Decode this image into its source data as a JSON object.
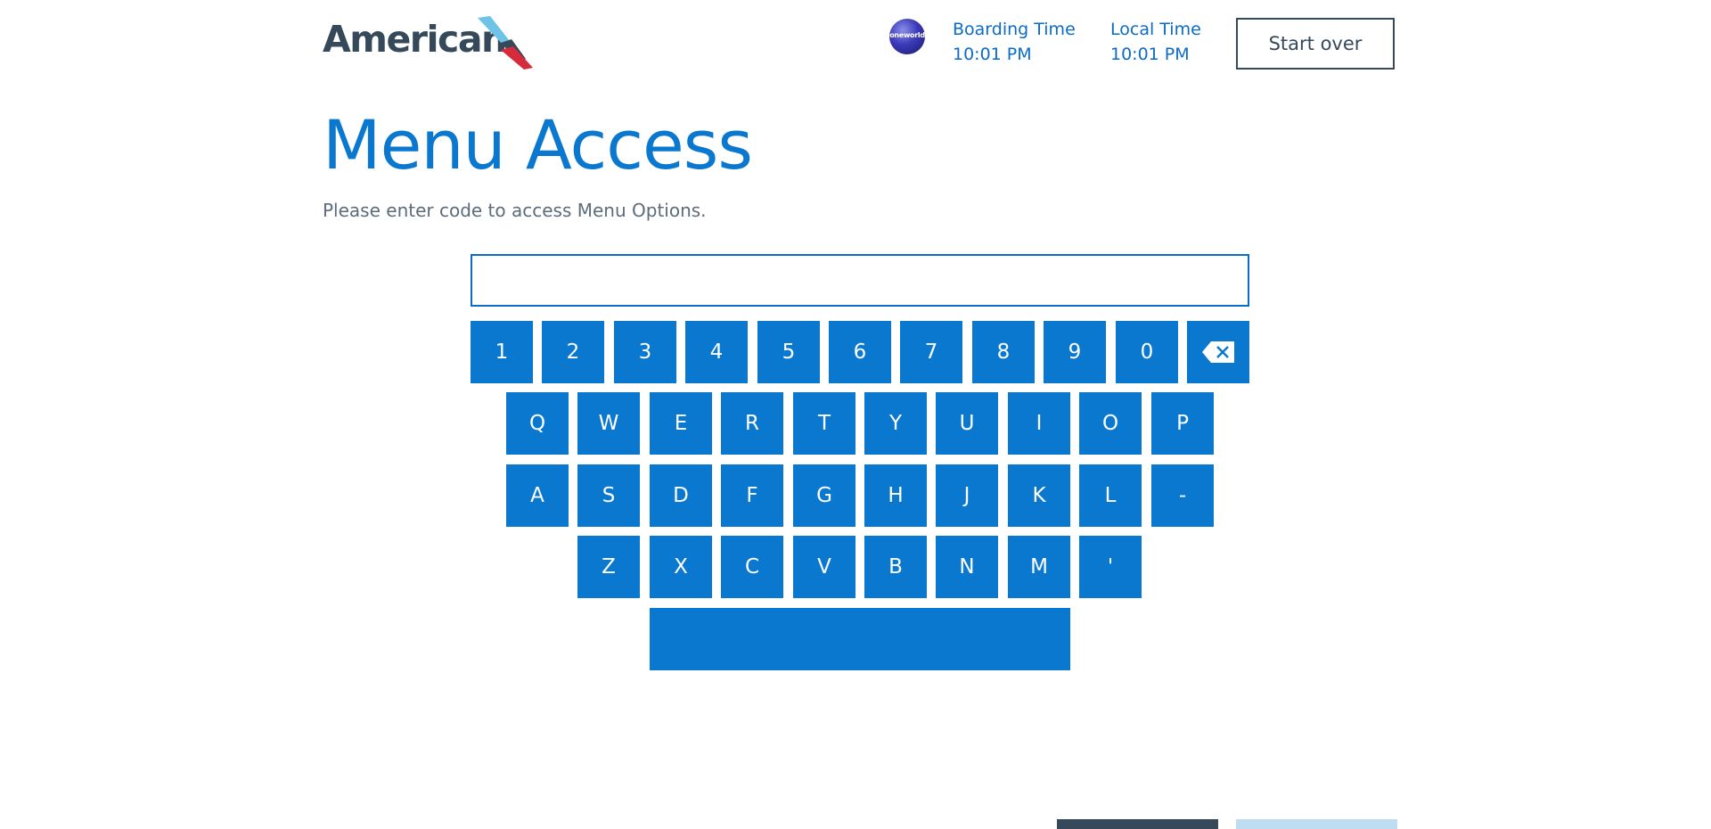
{
  "header": {
    "brand": "American",
    "oneworld": "oneworld",
    "boarding_label": "Boarding Time",
    "boarding_value": "10:01 PM",
    "local_label": "Local Time",
    "local_value": "10:01 PM",
    "start_over": "Start over"
  },
  "main": {
    "title": "Menu Access",
    "subtitle": "Please enter code to access Menu Options.",
    "code_value": "",
    "space_label": ""
  },
  "keyboard": {
    "row1": [
      "1",
      "2",
      "3",
      "4",
      "5",
      "6",
      "7",
      "8",
      "9",
      "0"
    ],
    "row2": [
      "Q",
      "W",
      "E",
      "R",
      "T",
      "Y",
      "U",
      "I",
      "O",
      "P"
    ],
    "row3": [
      "A",
      "S",
      "D",
      "F",
      "G",
      "H",
      "J",
      "K",
      "L",
      "-"
    ],
    "row4": [
      "Z",
      "X",
      "C",
      "V",
      "B",
      "N",
      "M",
      "'"
    ],
    "backspace_icon": "backspace-icon"
  },
  "colors": {
    "primary": "#0b78d0",
    "dark": "#36495a",
    "light": "#bfddf2"
  }
}
